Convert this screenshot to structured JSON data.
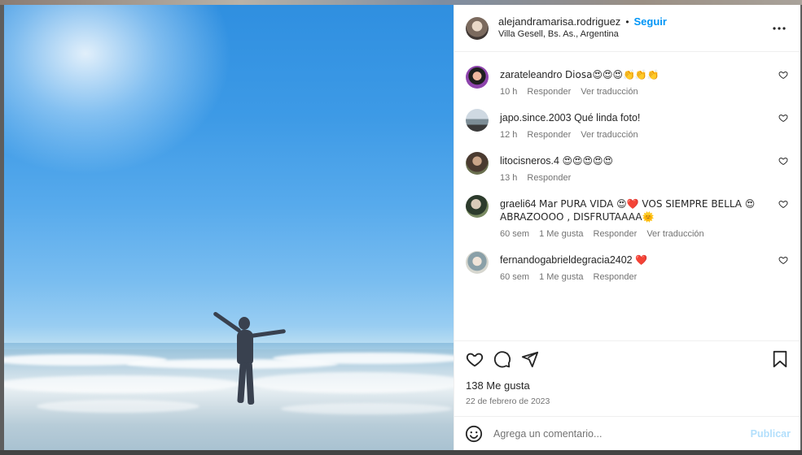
{
  "post": {
    "username": "alejandramarisa.rodriguez",
    "separator": "•",
    "follow_label": "Seguir",
    "location": "Villa Gesell, Bs. As., Argentina",
    "likes": "138 Me gusta",
    "date": "22 de febrero de 2023"
  },
  "comments": [
    {
      "user": "zarateleandro",
      "text": "Diosa😍😍😍👏👏👏",
      "time": "10 h",
      "reply": "Responder",
      "translate": "Ver traducción",
      "likes": ""
    },
    {
      "user": "japo.since.2003",
      "text": "Qué linda foto!",
      "time": "12 h",
      "reply": "Responder",
      "translate": "Ver traducción",
      "likes": ""
    },
    {
      "user": "litocisneros.4",
      "text": "😍😍😍😍😍",
      "time": "13 h",
      "reply": "Responder",
      "translate": "",
      "likes": ""
    },
    {
      "user": "graeli64",
      "text": "Mar PURA VIDA 😍❤️ VOS SIEMPRE BELLA 😍 ABRAZOOOO , DISFRUTAAAA🌞",
      "time": "60 sem",
      "reply": "Responder",
      "translate": "Ver traducción",
      "likes": "1 Me gusta"
    },
    {
      "user": "fernandogabrieldegracia2402",
      "text": "❤️",
      "time": "60 sem",
      "reply": "Responder",
      "translate": "",
      "likes": "1 Me gusta"
    }
  ],
  "composer": {
    "placeholder": "Agrega un comentario...",
    "publish_label": "Publicar"
  },
  "colors": {
    "accent": "#0095f6",
    "publish_disabled": "#b2dffc",
    "secondary_text": "#737373"
  },
  "icons": {
    "more": "more-icon",
    "like": "heart-icon",
    "comment": "comment-icon",
    "share": "share-icon",
    "save": "bookmark-icon",
    "emoji": "emoji-icon"
  }
}
